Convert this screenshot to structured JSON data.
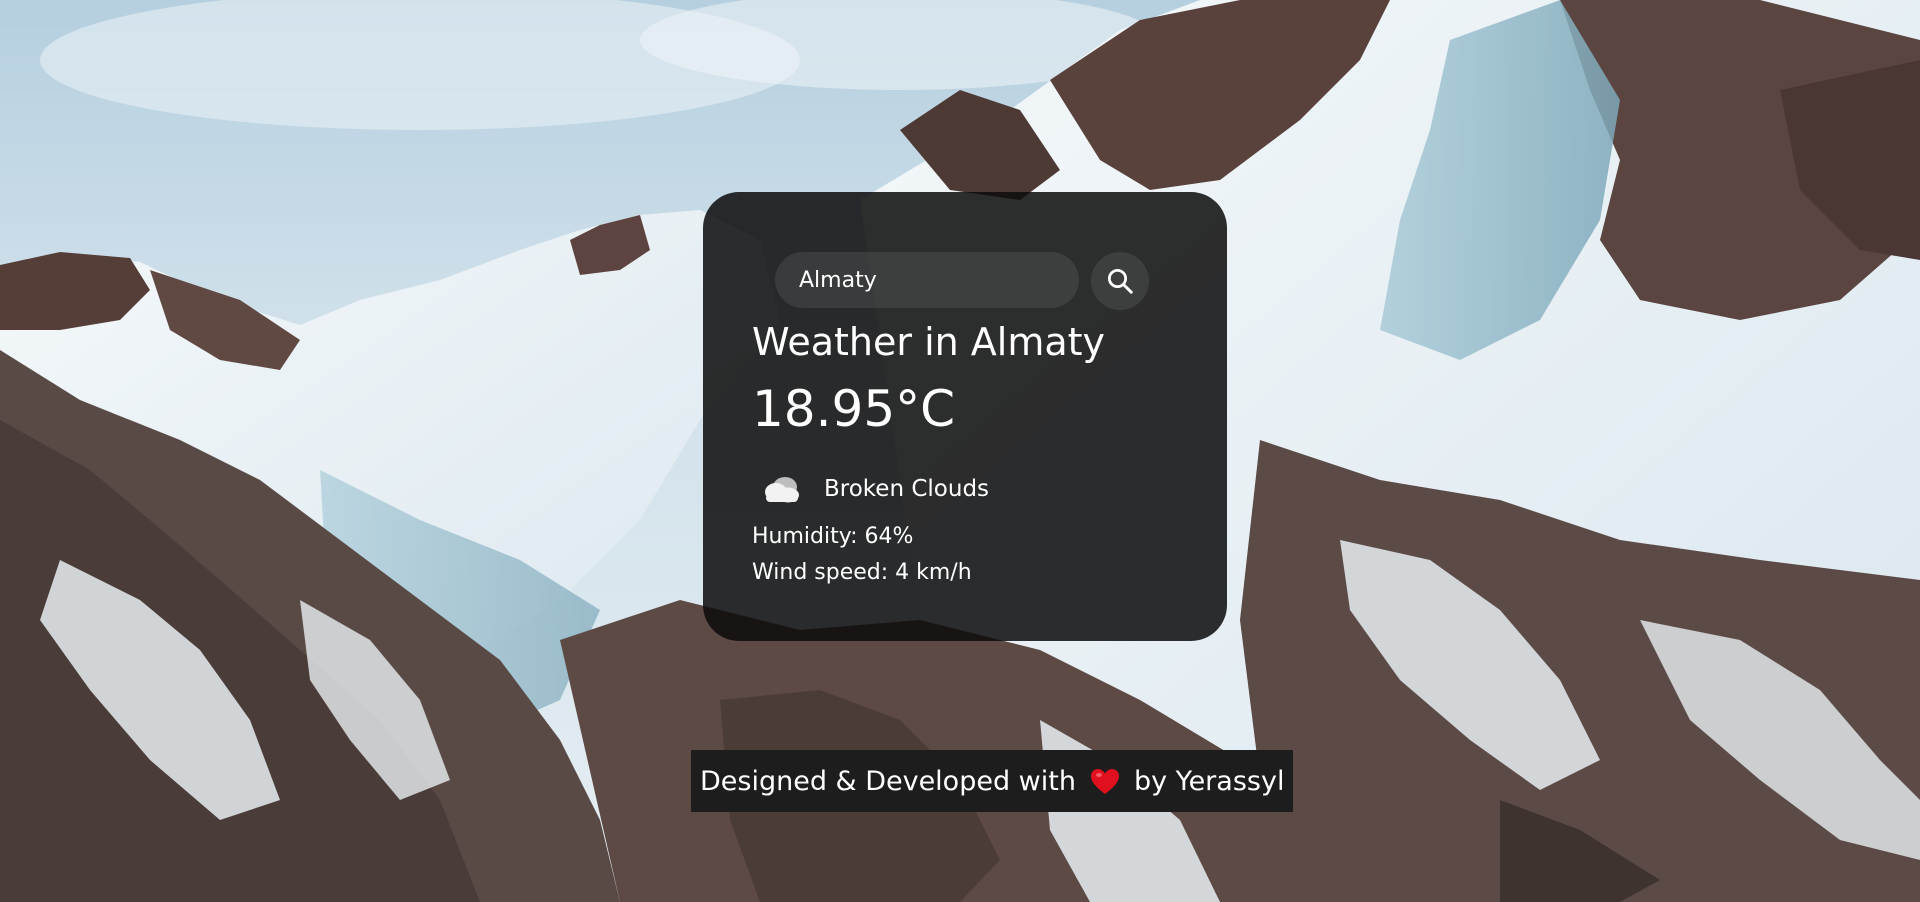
{
  "search": {
    "value": "Almaty",
    "placeholder": "Search"
  },
  "weather": {
    "title": "Weather in Almaty",
    "temperature": "18.95°C",
    "description": "Broken Clouds",
    "icon": "broken-clouds-icon",
    "humidity": "Humidity: 64%",
    "wind": "Wind speed: 4 km/h"
  },
  "footer": {
    "prefix": "Designed & Developed with",
    "suffix": "by Yerassyl",
    "icon": "heart-icon"
  },
  "colors": {
    "card_background": "#0c0c0c",
    "footer_background": "#1d1d1d",
    "text": "#ffffff",
    "heart": "#e0101e"
  }
}
